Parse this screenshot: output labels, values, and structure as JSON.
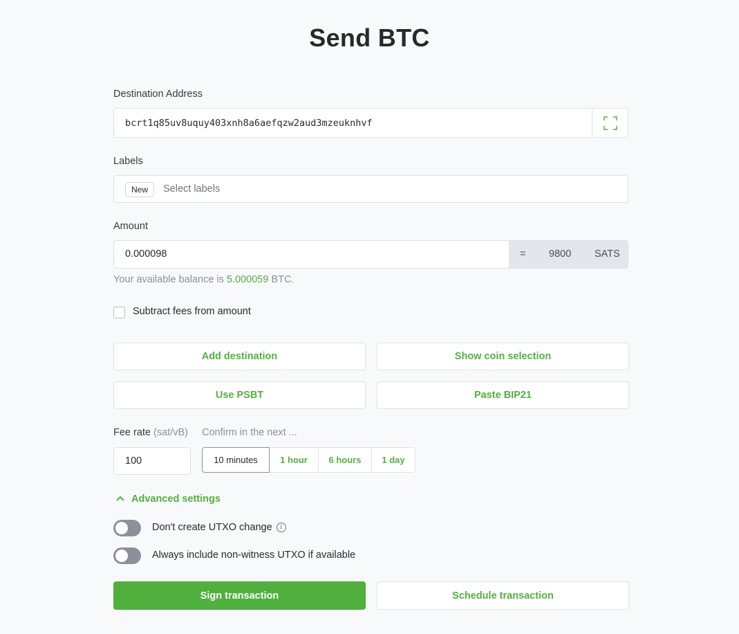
{
  "page": {
    "title": "Send BTC"
  },
  "destination": {
    "label": "Destination Address",
    "value": "bcrt1q85uv8uquy403xnh8a6aefqzw2aud3mzeuknhvf",
    "scan_icon": "qr-scan-icon"
  },
  "labels": {
    "label": "Labels",
    "badge": "New",
    "placeholder": "Select labels"
  },
  "amount": {
    "label": "Amount",
    "value": "0.000098",
    "equals": "=",
    "sats_value": "9800",
    "unit": "SATS",
    "balance_prefix": "Your available balance is ",
    "balance_value": "5.000059",
    "balance_suffix": " BTC."
  },
  "subtract_fees": {
    "label": "Subtract fees from amount",
    "checked": false
  },
  "buttons": {
    "add_destination": "Add destination",
    "show_coin_selection": "Show coin selection",
    "use_psbt": "Use PSBT",
    "paste_bip21": "Paste BIP21",
    "sign_transaction": "Sign transaction",
    "schedule_transaction": "Schedule transaction"
  },
  "fee": {
    "label": "Fee rate",
    "unit": "(sat/vB)",
    "value": "100",
    "confirm_label": "Confirm in the next ...",
    "options": [
      "10 minutes",
      "1 hour",
      "6 hours",
      "1 day"
    ],
    "selected": "10 minutes"
  },
  "advanced": {
    "label": "Advanced settings",
    "icon": "chevron-up-icon",
    "toggles": [
      {
        "label": "Don't create UTXO change",
        "on": false,
        "info_icon": "info-icon"
      },
      {
        "label": "Always include non-witness UTXO if available",
        "on": false
      }
    ]
  },
  "colors": {
    "accent": "#51b13e",
    "primary_button": "#4fb03e",
    "background": "#f8f9fa",
    "toggle_off": "#8a9199"
  }
}
